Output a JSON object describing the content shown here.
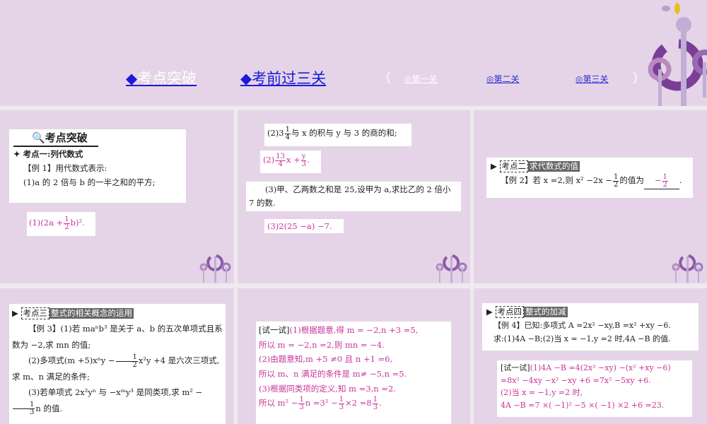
{
  "nav": {
    "tab1": "考点突破",
    "tab2": "考前过三关",
    "diamond": "◆",
    "open_paren": "（",
    "close_paren": "）",
    "level1": "◎第一关",
    "level2": "◎第二关",
    "level3": "◎第三关"
  },
  "p1": {
    "heading": "考点突破",
    "topic": "考点一:列代数式",
    "ex": "【例 1】用代数式表示:",
    "q1": "(1)a 的 2 倍与 b 的一半之和的平方;",
    "a1_pre": "(1)(2a +",
    "a1_num": "1",
    "a1_den": "2",
    "a1_post": "b)²."
  },
  "p2": {
    "q2_pre": "(2)3",
    "q2_num": "1",
    "q2_den": "4",
    "q2_post": "与 x 的积与 y 与 3 的商的和;",
    "a2_pre": "(2)",
    "a2_num1": "13",
    "a2_den1": "4",
    "a2_mid": "x +",
    "a2_num2": "y",
    "a2_den2": "3",
    "a2_post": ".",
    "q3": "(3)甲、乙两数之和是 25,设甲为 a,求比乙的 2 倍小 7 的数.",
    "a3": "(3)2(25 −a) −7."
  },
  "p3": {
    "tag": "考点二",
    "title": "求代数式的值",
    "ex_pre": "【例 2】若 x =2,则 x² −2x −",
    "num": "1",
    "den": "2",
    "ex_post": "的值为",
    "ans_num": "1",
    "ans_den": "2",
    "ans_sign": "−",
    "end": "."
  },
  "p4": {
    "tag": "考点三",
    "title": "整式的相关概念的运用",
    "q1": "【例 3】(1)若 maⁿb³ 是关于 a、b 的五次单项式且系数为 −2,求 mn 的值;",
    "q2_pre": "(2)多项式(m +5)xⁿy −",
    "q2_num": "1",
    "q2_den": "2",
    "q2_post": "x²y +4 是六次三项式,求 m、n 满足的条件;",
    "q3_pre": "(3)若单项式 2x²yⁿ 与 −xᵐy³ 是同类项,求 m² −",
    "q3_num": "1",
    "q3_den": "3",
    "q3_post": "n",
    "q3_end": "的值."
  },
  "p5": {
    "label": "[试一试]",
    "l1": "(1)根据题意,得 m = −2,n +3 =5,",
    "l2": "所以 m = −2,n =2,则 mn = −4.",
    "l3": "(2)由题意知,m +5 ≠0 且 n +1 =6,",
    "l4": "所以 m、n 满足的条件是 m≠ −5,n =5.",
    "l5": "(3)根据同类项的定义,知 m =3,n =2.",
    "l6_pre": "所以 m² −",
    "f1n": "1",
    "f1d": "3",
    "l6_mid": "n =3² −",
    "f2n": "1",
    "f2d": "3",
    "l6_mid2": "×2 =8",
    "f3n": "1",
    "f3d": "3",
    "l6_end": "."
  },
  "p6": {
    "tag": "考点四",
    "title": "整式的加减",
    "q1": "【例 4】已知:多项式 A =2x² −xy,B =x² +xy −6.",
    "q2": "求:(1)4A −B;(2)当 x = −1,y =2 时,4A −B 的值.",
    "label": "[试一试]",
    "l1": "(1)4A −B =4(2x² −xy) −(x² +xy −6)",
    "l2": "=8x² −4xy −x² −xy +6 =7x² −5xy +6.",
    "l3": "(2)当 x = −1,y =2 时,",
    "l4": "4A −B =7 ×( −1)² −5 ×( −1) ×2 +6 =23."
  },
  "colors": {
    "background": "#e5d4e7",
    "answer": "#c8349a",
    "nav": "#1a1ad8"
  }
}
